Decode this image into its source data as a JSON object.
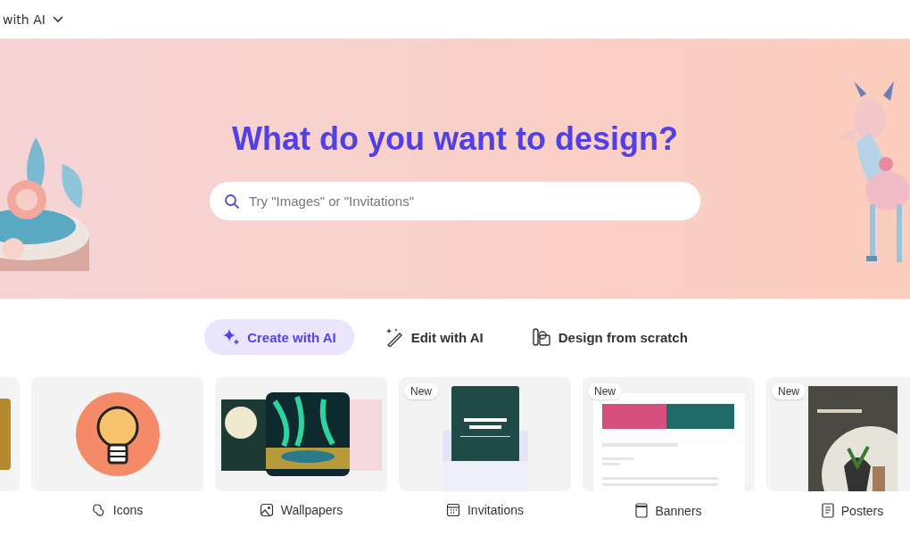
{
  "top_bar": {
    "menu_label": "with AI"
  },
  "hero": {
    "title": "What do you want to design?",
    "search": {
      "placeholder": "Try \"Images\" or \"Invitations\""
    }
  },
  "modes": [
    {
      "kind": "create",
      "label": "Create with AI",
      "selected": true
    },
    {
      "kind": "edit",
      "label": "Edit with AI",
      "selected": false
    },
    {
      "kind": "scratch",
      "label": "Design from scratch",
      "selected": false
    }
  ],
  "cards": [
    {
      "kind": "photo"
    },
    {
      "kind": "bulb",
      "label": "Icons"
    },
    {
      "kind": "wallpaper",
      "label": "Wallpapers"
    },
    {
      "kind": "invitation",
      "label": "Invitations",
      "badge": "New"
    },
    {
      "kind": "banner",
      "label": "Banners",
      "badge": "New"
    },
    {
      "kind": "poster",
      "label": "Posters",
      "badge": "New"
    }
  ]
}
